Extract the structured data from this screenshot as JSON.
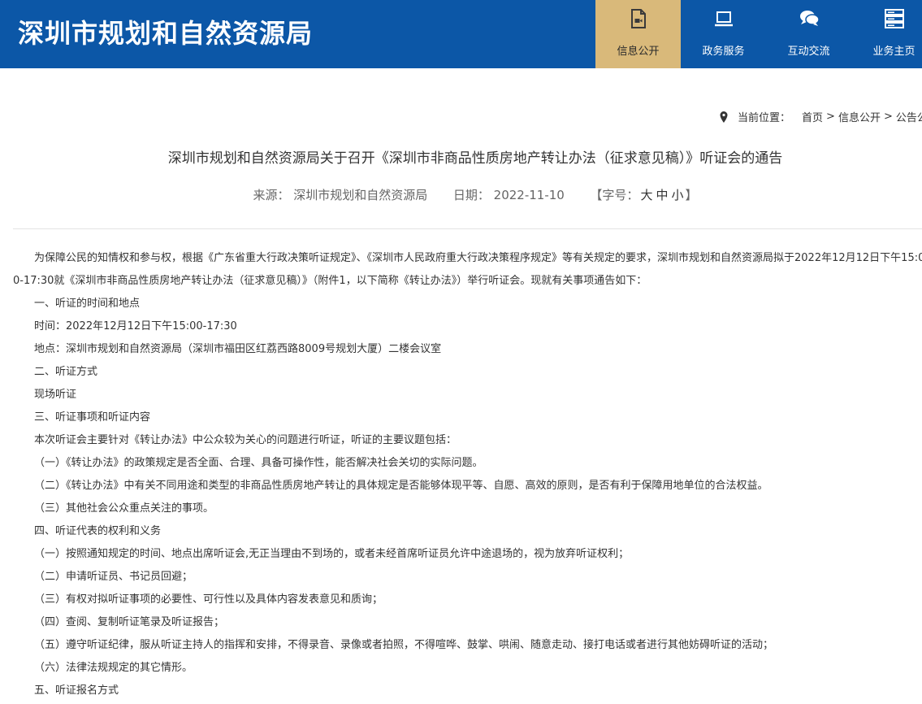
{
  "header": {
    "site_title": "深圳市规划和自然资源局",
    "nav": [
      {
        "label": "信息公开",
        "icon": "document-video-icon",
        "active": true
      },
      {
        "label": "政务服务",
        "icon": "laptop-icon",
        "active": false
      },
      {
        "label": "互动交流",
        "icon": "chat-bubbles-icon",
        "active": false
      },
      {
        "label": "业务主页",
        "icon": "server-icon",
        "active": false
      }
    ],
    "accent_color": "#0c57a7",
    "active_tab_color": "#d9b97a"
  },
  "breadcrumb": {
    "prefix": "当前位置：",
    "items": [
      "首页",
      "信息公开",
      "公告公"
    ],
    "separator": ">"
  },
  "article": {
    "title": "深圳市规划和自然资源局关于召开《深圳市非商品性质房地产转让办法（征求意见稿）》听证会的通告",
    "source_label": "来源：",
    "source_value": "深圳市规划和自然资源局",
    "date_label": "日期：",
    "date_value": "2022-11-10",
    "font_label": "【字号：",
    "font_large": "大",
    "font_medium": "中",
    "font_small": "小",
    "font_close": "】",
    "intro": "为保障公民的知情权和参与权，根据《广东省重大行政决策听证规定》、《深圳市人民政府重大行政决策程序规定》等有关规定的要求，深圳市规划和自然资源局拟于2022年12月12日下午15:00-17:30就《深圳市非商品性质房地产转让办法（征求意见稿）》（附件1，以下简称《转让办法》）举行听证会。现就有关事项通告如下：",
    "lines": [
      "一、听证的时间和地点",
      "时间：2022年12月12日下午15:00-17:30",
      "地点：深圳市规划和自然资源局（深圳市福田区红荔西路8009号规划大厦）二楼会议室",
      "二、听证方式",
      "现场听证",
      "三、听证事项和听证内容",
      "本次听证会主要针对《转让办法》中公众较为关心的问题进行听证，听证的主要议题包括：",
      "（一）《转让办法》的政策规定是否全面、合理、具备可操作性，能否解决社会关切的实际问题。",
      "（二）《转让办法》中有关不同用途和类型的非商品性质房地产转让的具体规定是否能够体现平等、自愿、高效的原则，是否有利于保障用地单位的合法权益。",
      "（三）其他社会公众重点关注的事项。",
      "四、听证代表的权利和义务",
      "（一）按照通知规定的时间、地点出席听证会,无正当理由不到场的，或者未经首席听证员允许中途退场的，视为放弃听证权利；",
      "（二）申请听证员、书记员回避；",
      "（三）有权对拟听证事项的必要性、可行性以及具体内容发表意见和质询；",
      "（四）查阅、复制听证笔录及听证报告；",
      "（五）遵守听证纪律，服从听证主持人的指挥和安排，不得录音、录像或者拍照，不得喧哗、鼓掌、哄闹、随意走动、接打电话或者进行其他妨碍听证的活动；",
      "（六）法律法规规定的其它情形。",
      "五、听证报名方式"
    ]
  }
}
